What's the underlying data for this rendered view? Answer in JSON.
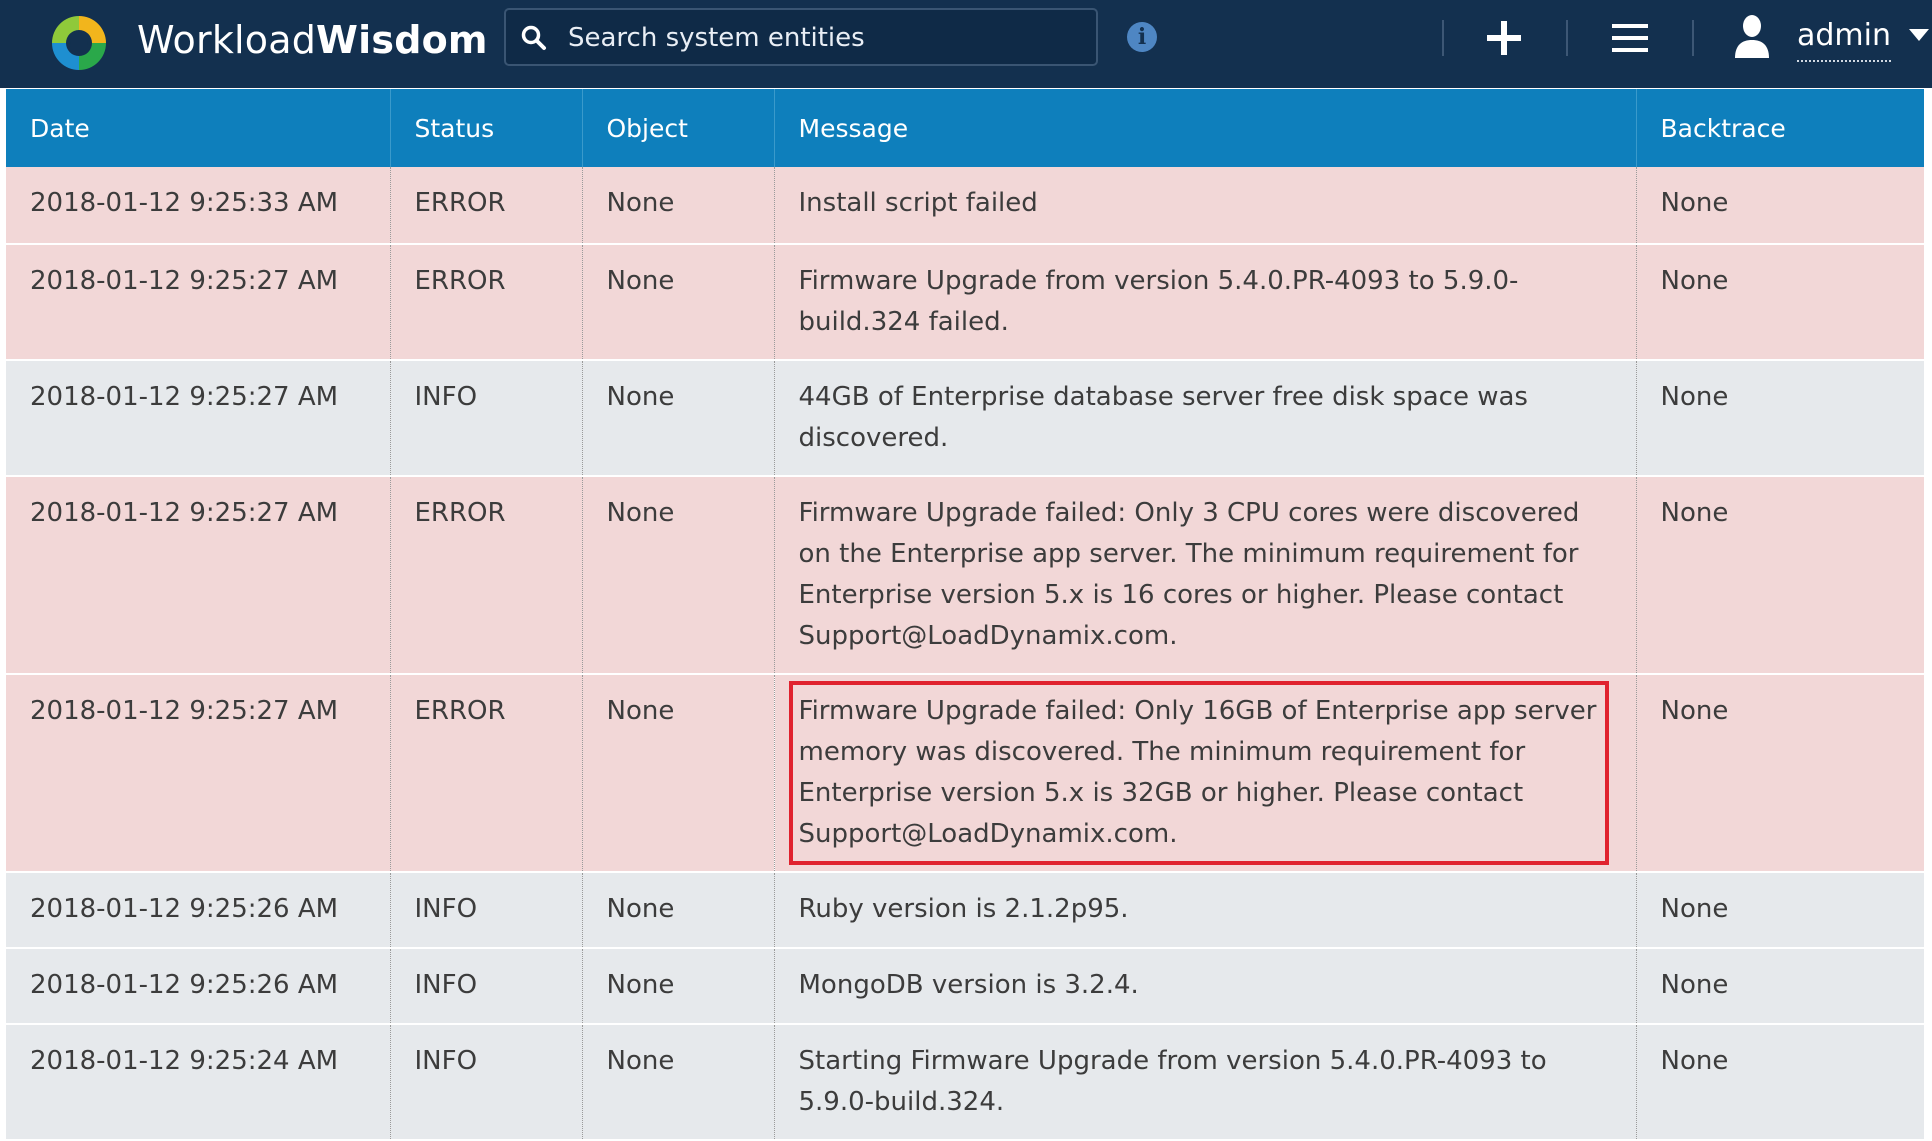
{
  "header": {
    "brand_part1": "Workload",
    "brand_part2": "Wisdom",
    "search_placeholder": "Search system entities",
    "user_name": "admin"
  },
  "icons": {
    "logo": "workloadwisdom-logo-icon",
    "search": "search-icon",
    "info": "info-icon",
    "add": "plus-icon",
    "menu": "hamburger-menu-icon",
    "user": "user-icon",
    "dropdown": "caret-down-icon"
  },
  "colors": {
    "topbar": "#13304f",
    "table_header": "#0e7fbc",
    "error_row": "#f2d7d7",
    "info_row": "#e6e9ec",
    "highlight": "#e0222e"
  },
  "table": {
    "columns": [
      "Date",
      "Status",
      "Object",
      "Message",
      "Backtrace"
    ],
    "rows": [
      {
        "date": "2018-01-12 9:25:33 AM",
        "status": "ERROR",
        "object": "None",
        "message": "Install script failed",
        "backtrace": "None"
      },
      {
        "date": "2018-01-12 9:25:27 AM",
        "status": "ERROR",
        "object": "None",
        "message": "Firmware Upgrade from version 5.4.0.PR-4093 to 5.9.0-build.324 failed.",
        "backtrace": "None"
      },
      {
        "date": "2018-01-12 9:25:27 AM",
        "status": "INFO",
        "object": "None",
        "message": "44GB of Enterprise database server free disk space was discovered.",
        "backtrace": "None"
      },
      {
        "date": "2018-01-12 9:25:27 AM",
        "status": "ERROR",
        "object": "None",
        "message": "Firmware Upgrade failed: Only 3 CPU cores were discovered on the Enterprise app server. The minimum requirement for Enterprise version 5.x is 16 cores or higher. Please contact Support@LoadDynamix.com.",
        "backtrace": "None"
      },
      {
        "date": "2018-01-12 9:25:27 AM",
        "status": "ERROR",
        "object": "None",
        "message": "Firmware Upgrade failed: Only 16GB of Enterprise app server memory was discovered. The minimum requirement for Enterprise version 5.x is 32GB or higher. Please contact Support@LoadDynamix.com.",
        "backtrace": "None"
      },
      {
        "date": "2018-01-12 9:25:26 AM",
        "status": "INFO",
        "object": "None",
        "message": "Ruby version is 2.1.2p95.",
        "backtrace": "None"
      },
      {
        "date": "2018-01-12 9:25:26 AM",
        "status": "INFO",
        "object": "None",
        "message": "MongoDB version is 3.2.4.",
        "backtrace": "None"
      },
      {
        "date": "2018-01-12 9:25:24 AM",
        "status": "INFO",
        "object": "None",
        "message": "Starting Firmware Upgrade from version 5.4.0.PR-4093 to 5.9.0-build.324.",
        "backtrace": "None"
      }
    ]
  }
}
